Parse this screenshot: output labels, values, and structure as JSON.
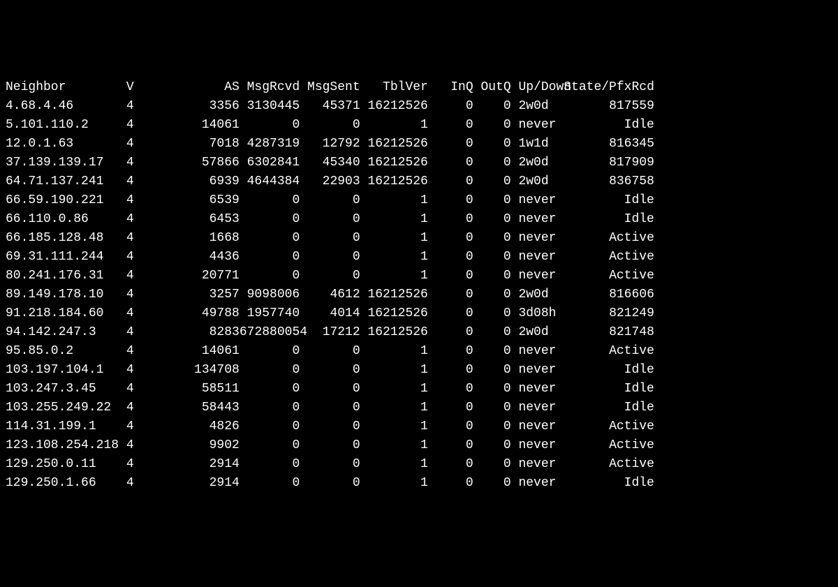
{
  "headers": {
    "neighbor": "Neighbor",
    "v": "V",
    "as": "AS",
    "msgrcvd": "MsgRcvd",
    "msgsent": "MsgSent",
    "tblver": "TblVer",
    "inq": "InQ",
    "outq": "OutQ",
    "updown": "Up/Down",
    "state": "State/PfxRcd"
  },
  "rows": [
    {
      "neighbor": "4.68.4.46",
      "v": "4",
      "as": "3356",
      "msgrcvd": "3130445",
      "msgsent": "45371",
      "tblver": "16212526",
      "inq": "0",
      "outq": "0",
      "updown": "2w0d",
      "state": "817559"
    },
    {
      "neighbor": "5.101.110.2",
      "v": "4",
      "as": "14061",
      "msgrcvd": "0",
      "msgsent": "0",
      "tblver": "1",
      "inq": "0",
      "outq": "0",
      "updown": "never",
      "state": "Idle"
    },
    {
      "neighbor": "12.0.1.63",
      "v": "4",
      "as": "7018",
      "msgrcvd": "4287319",
      "msgsent": "12792",
      "tblver": "16212526",
      "inq": "0",
      "outq": "0",
      "updown": "1w1d",
      "state": "816345"
    },
    {
      "neighbor": "37.139.139.17",
      "v": "4",
      "as": "57866",
      "msgrcvd": "6302841",
      "msgsent": "45340",
      "tblver": "16212526",
      "inq": "0",
      "outq": "0",
      "updown": "2w0d",
      "state": "817909"
    },
    {
      "neighbor": "64.71.137.241",
      "v": "4",
      "as": "6939",
      "msgrcvd": "4644384",
      "msgsent": "22903",
      "tblver": "16212526",
      "inq": "0",
      "outq": "0",
      "updown": "2w0d",
      "state": "836758"
    },
    {
      "neighbor": "66.59.190.221",
      "v": "4",
      "as": "6539",
      "msgrcvd": "0",
      "msgsent": "0",
      "tblver": "1",
      "inq": "0",
      "outq": "0",
      "updown": "never",
      "state": "Idle"
    },
    {
      "neighbor": "66.110.0.86",
      "v": "4",
      "as": "6453",
      "msgrcvd": "0",
      "msgsent": "0",
      "tblver": "1",
      "inq": "0",
      "outq": "0",
      "updown": "never",
      "state": "Idle"
    },
    {
      "neighbor": "66.185.128.48",
      "v": "4",
      "as": "1668",
      "msgrcvd": "0",
      "msgsent": "0",
      "tblver": "1",
      "inq": "0",
      "outq": "0",
      "updown": "never",
      "state": "Active"
    },
    {
      "neighbor": "69.31.111.244",
      "v": "4",
      "as": "4436",
      "msgrcvd": "0",
      "msgsent": "0",
      "tblver": "1",
      "inq": "0",
      "outq": "0",
      "updown": "never",
      "state": "Active"
    },
    {
      "neighbor": "80.241.176.31",
      "v": "4",
      "as": "20771",
      "msgrcvd": "0",
      "msgsent": "0",
      "tblver": "1",
      "inq": "0",
      "outq": "0",
      "updown": "never",
      "state": "Active"
    },
    {
      "neighbor": "89.149.178.10",
      "v": "4",
      "as": "3257",
      "msgrcvd": "9098006",
      "msgsent": "4612",
      "tblver": "16212526",
      "inq": "0",
      "outq": "0",
      "updown": "2w0d",
      "state": "816606"
    },
    {
      "neighbor": "91.218.184.60",
      "v": "4",
      "as": "49788",
      "msgrcvd": "1957740",
      "msgsent": "4014",
      "tblver": "16212526",
      "inq": "0",
      "outq": "0",
      "updown": "3d08h",
      "state": "821249"
    },
    {
      "neighbor": "94.142.247.3",
      "v": "4",
      "as": "8283",
      "msgrcvd": "672880054",
      "msgsent": "17212",
      "tblver": "16212526",
      "inq": "0",
      "outq": "0",
      "updown": "2w0d",
      "state": "821748"
    },
    {
      "neighbor": "95.85.0.2",
      "v": "4",
      "as": "14061",
      "msgrcvd": "0",
      "msgsent": "0",
      "tblver": "1",
      "inq": "0",
      "outq": "0",
      "updown": "never",
      "state": "Active"
    },
    {
      "neighbor": "103.197.104.1",
      "v": "4",
      "as": "134708",
      "msgrcvd": "0",
      "msgsent": "0",
      "tblver": "1",
      "inq": "0",
      "outq": "0",
      "updown": "never",
      "state": "Idle"
    },
    {
      "neighbor": "103.247.3.45",
      "v": "4",
      "as": "58511",
      "msgrcvd": "0",
      "msgsent": "0",
      "tblver": "1",
      "inq": "0",
      "outq": "0",
      "updown": "never",
      "state": "Idle"
    },
    {
      "neighbor": "103.255.249.22",
      "v": "4",
      "as": "58443",
      "msgrcvd": "0",
      "msgsent": "0",
      "tblver": "1",
      "inq": "0",
      "outq": "0",
      "updown": "never",
      "state": "Idle"
    },
    {
      "neighbor": "114.31.199.1",
      "v": "4",
      "as": "4826",
      "msgrcvd": "0",
      "msgsent": "0",
      "tblver": "1",
      "inq": "0",
      "outq": "0",
      "updown": "never",
      "state": "Active"
    },
    {
      "neighbor": "123.108.254.218",
      "v": "4",
      "as": "9902",
      "msgrcvd": "0",
      "msgsent": "0",
      "tblver": "1",
      "inq": "0",
      "outq": "0",
      "updown": "never",
      "state": "Active"
    },
    {
      "neighbor": "129.250.0.11",
      "v": "4",
      "as": "2914",
      "msgrcvd": "0",
      "msgsent": "0",
      "tblver": "1",
      "inq": "0",
      "outq": "0",
      "updown": "never",
      "state": "Active"
    },
    {
      "neighbor": "129.250.1.66",
      "v": "4",
      "as": "2914",
      "msgrcvd": "0",
      "msgsent": "0",
      "tblver": "1",
      "inq": "0",
      "outq": "0",
      "updown": "never",
      "state": "Idle"
    }
  ]
}
